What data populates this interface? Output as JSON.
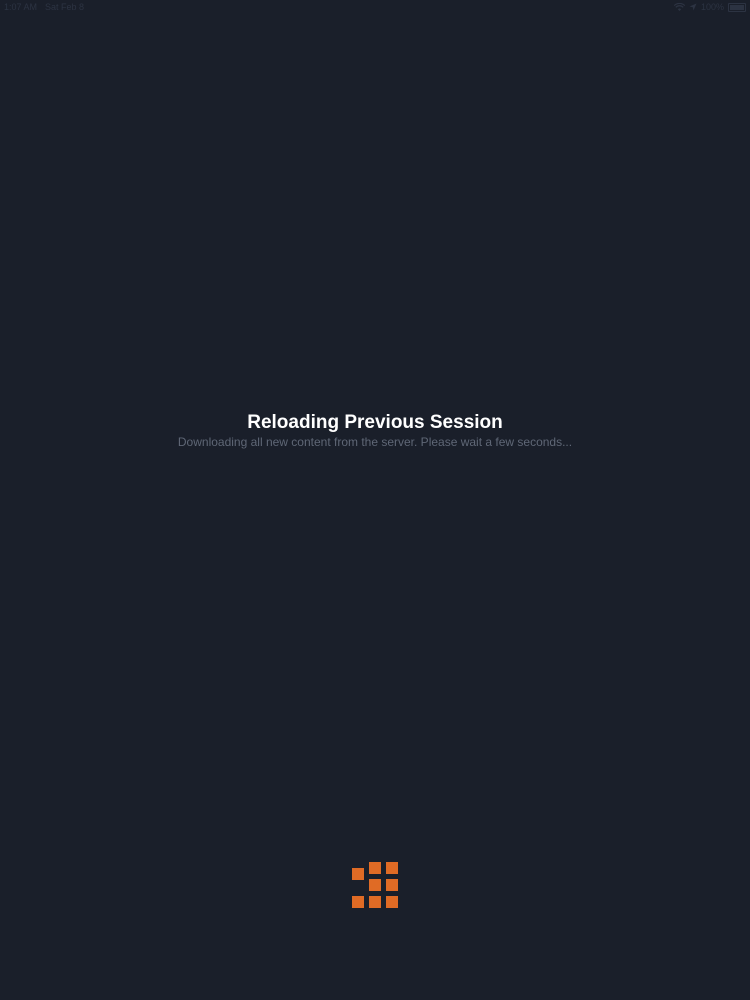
{
  "status_bar": {
    "time": "1:07 AM",
    "date": "Sat Feb 8",
    "battery_text": "100%",
    "battery_level": 1.0,
    "icons": [
      "wifi-icon",
      "location-arrow-icon",
      "battery-icon"
    ]
  },
  "loading": {
    "title": "Reloading Previous Session",
    "subtitle": "Downloading all new content from the server. Please wait a few seconds..."
  },
  "spinner": {
    "icon": "loading-grid-icon",
    "color": "#e06b25"
  },
  "colors": {
    "background": "#1a1f2a",
    "accent": "#e06b25"
  }
}
